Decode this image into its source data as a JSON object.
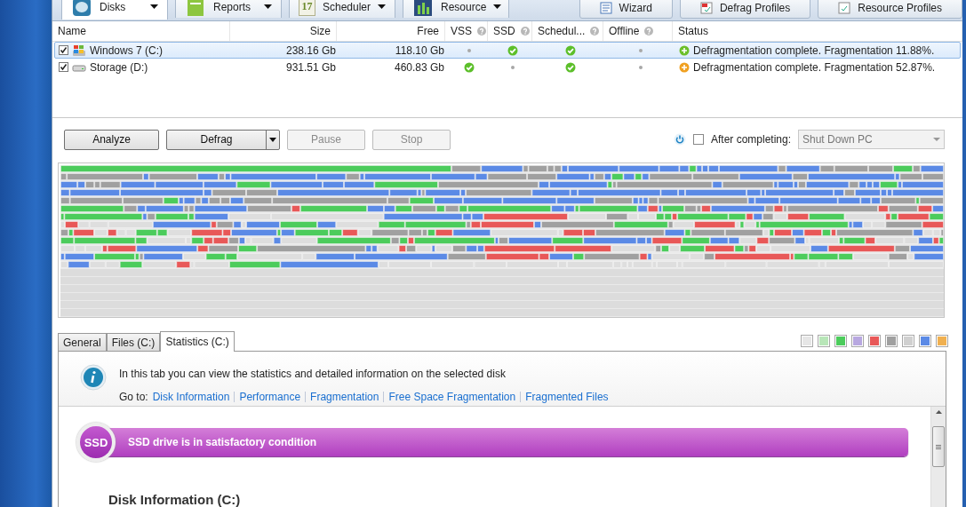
{
  "top_tabs": [
    {
      "label": "Disks",
      "selected": true,
      "kind": "disks"
    },
    {
      "label": "Reports",
      "selected": false,
      "kind": "reports"
    },
    {
      "label": "Scheduler",
      "selected": false,
      "kind": "scheduler",
      "icon_label": "17"
    },
    {
      "label": "Resource",
      "selected": false,
      "kind": "resource"
    }
  ],
  "top_buttons": [
    {
      "label": "Wizard"
    },
    {
      "label": "Defrag Profiles"
    },
    {
      "label": "Resource Profiles"
    }
  ],
  "disk_table": {
    "columns": [
      {
        "label": "Name",
        "help": false
      },
      {
        "label": "Size",
        "help": false
      },
      {
        "label": "Free",
        "help": false
      },
      {
        "label": "VSS",
        "help": true
      },
      {
        "label": "SSD",
        "help": true
      },
      {
        "label": "Schedul...",
        "help": true
      },
      {
        "label": "Offline",
        "help": true
      },
      {
        "label": "Status",
        "help": false
      }
    ],
    "rows": [
      {
        "checked": true,
        "selected": true,
        "kind": "system",
        "name": "Windows 7 (C:)",
        "size": "238.16 Gb",
        "free": "118.10 Gb",
        "vss": false,
        "ssd": true,
        "scheduler": true,
        "offline": false,
        "color": "#6cbf2a",
        "status": "Defragmentation complete. Fragmentation 11.88%."
      },
      {
        "checked": true,
        "selected": false,
        "kind": "drive",
        "name": "Storage (D:)",
        "size": "931.51 Gb",
        "free": "460.83 Gb",
        "vss": true,
        "ssd": false,
        "scheduler": true,
        "offline": false,
        "color": "#f0a020",
        "status": "Defragmentation complete. Fragmentation 52.87%."
      }
    ]
  },
  "actions": [
    {
      "label": "Analyze",
      "disabled": false,
      "dropdown": false
    },
    {
      "label": "Defrag",
      "disabled": false,
      "dropdown": true
    },
    {
      "label": "Pause",
      "disabled": true,
      "dropdown": false
    },
    {
      "label": "Stop",
      "disabled": true,
      "dropdown": false
    }
  ],
  "after_completing": {
    "checked": false,
    "label": "After completing:",
    "value": "Shut Down PC",
    "disabled": true
  },
  "detail_tabs": [
    {
      "label": "General",
      "selected": false
    },
    {
      "label": "Files (C:)",
      "selected": false
    },
    {
      "label": "Statistics (C:)",
      "selected": true
    }
  ],
  "legend": [
    {
      "color": "#e6e6e6"
    },
    {
      "color": "#b8e6b8"
    },
    {
      "color": "#4ccc5c"
    },
    {
      "color": "#b8a8e0"
    },
    {
      "color": "#e85858"
    },
    {
      "color": "#a0a0a0"
    },
    {
      "color": "#d0d0d0"
    },
    {
      "color": "#5b8ae6"
    },
    {
      "color": "#f0b050"
    }
  ],
  "info": {
    "text": "In this tab you can view the statistics and detailed information on the selected disk",
    "goto_label": "Go to:",
    "links": [
      "Disk Information",
      "Performance",
      "Fragmentation",
      "Free Space Fragmentation",
      "Fragmented Files"
    ]
  },
  "ssd_banner": {
    "badge": "SSD",
    "text": "SSD drive is in satisfactory condition"
  },
  "section_heading": "Disk Information (C:)"
}
